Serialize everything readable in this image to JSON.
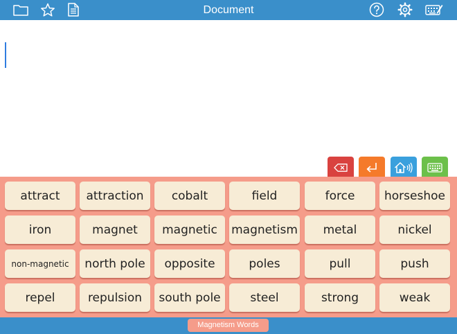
{
  "header": {
    "title": "Document",
    "icons": [
      "folder-icon",
      "star-icon",
      "document-icon",
      "help-icon",
      "gear-icon",
      "keyboard-edit-icon"
    ]
  },
  "controls": [
    {
      "name": "delete-button",
      "icon": "backspace-icon",
      "color": "#d9423f"
    },
    {
      "name": "return-button",
      "icon": "return-arrow-icon",
      "color": "#f57a2a"
    },
    {
      "name": "speak-button",
      "icon": "speaker-house-icon",
      "color": "#3aa0dd"
    },
    {
      "name": "keyboard-button",
      "icon": "keyboard-icon",
      "color": "#6cc04a"
    }
  ],
  "words": [
    [
      "attract",
      "attraction",
      "cobalt",
      "field",
      "force",
      "horseshoe"
    ],
    [
      "iron",
      "magnet",
      "magnetic",
      "magnetism",
      "metal",
      "nickel"
    ],
    [
      "non-magnetic",
      "north pole",
      "opposite",
      "poles",
      "pull",
      "push"
    ],
    [
      "repel",
      "repulsion",
      "south pole",
      "steel",
      "strong",
      "weak"
    ]
  ],
  "footer": {
    "word_set": "Magnetism Words"
  },
  "colors": {
    "bar": "#3a8fca",
    "panel": "#f59c8a",
    "tile": "#f7ecd6"
  }
}
